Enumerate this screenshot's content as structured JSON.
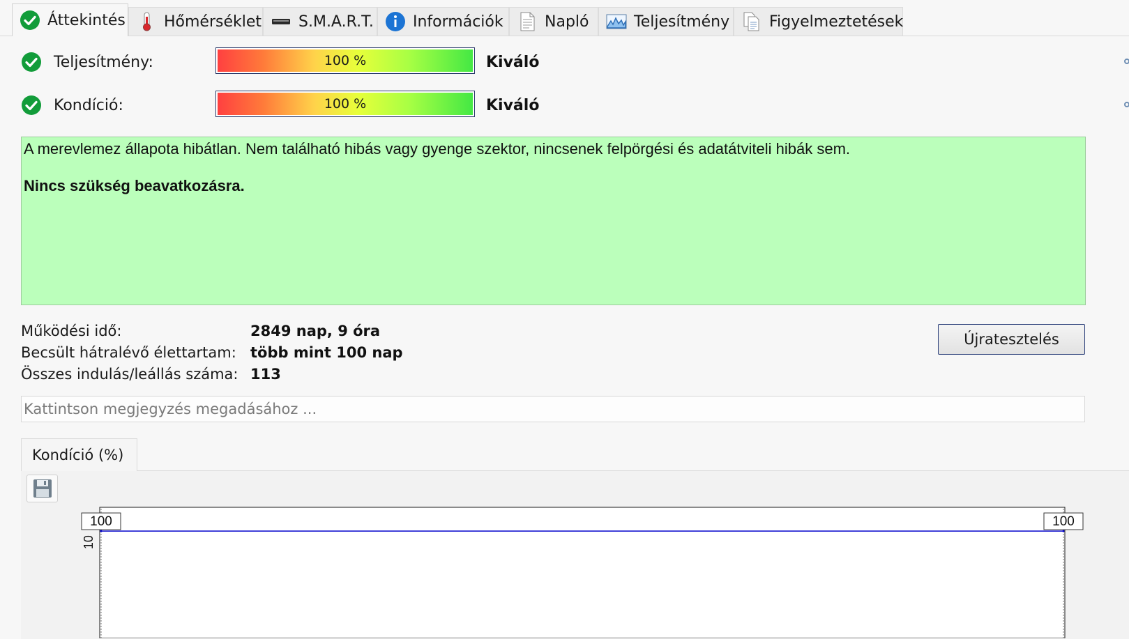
{
  "tabs": [
    {
      "label": "Áttekintés",
      "icon": "check-circle-icon",
      "active": true
    },
    {
      "label": "Hőmérséklet",
      "icon": "thermometer-icon"
    },
    {
      "label": "S.M.A.R.T.",
      "icon": "hard-drive-icon"
    },
    {
      "label": "Információk",
      "icon": "info-icon"
    },
    {
      "label": "Napló",
      "icon": "document-icon"
    },
    {
      "label": "Teljesítmény",
      "icon": "performance-chart-icon"
    },
    {
      "label": "Figyelmeztetések",
      "icon": "documents-icon"
    }
  ],
  "performance": {
    "label": "Teljesítmény:",
    "percent": "100 %",
    "level": 1.0,
    "status": "Kiváló"
  },
  "condition": {
    "label": "Kondíció:",
    "percent": "100 %",
    "level": 1.0,
    "status": "Kiváló"
  },
  "status_box": {
    "message": "A merevlemez állapota hibátlan. Nem található hibás vagy gyenge szektor, nincsenek felpörgési és adatátviteli hibák sem.",
    "action": "Nincs szükség beavatkozásra.",
    "bg_color": "#bbffbb"
  },
  "info": [
    {
      "label": "Működési idő:",
      "value": "2849 nap, 9 óra"
    },
    {
      "label": "Becsült hátralévő élettartam:",
      "value": "több mint 100 nap"
    },
    {
      "label": "Összes indulás/leállás száma:",
      "value": "113"
    }
  ],
  "retest_label": "Újratesztelés",
  "note_placeholder": "Kattintson megjegyzés megadásához ...",
  "chart_tab_label": "Kondíció  (%)",
  "chart_data": {
    "type": "line",
    "series": [
      {
        "values": [
          100,
          100
        ]
      }
    ],
    "point_labels": [
      "100",
      "100"
    ],
    "ytick_label": "10",
    "line_color": "#0000cc"
  }
}
